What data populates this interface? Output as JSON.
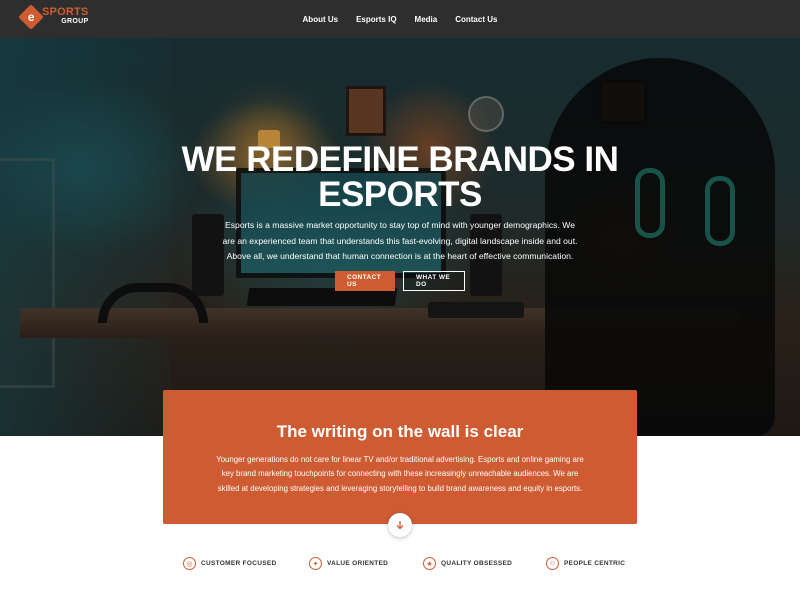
{
  "brand": {
    "logo_mark": "e",
    "logo_top": "SPORTS",
    "logo_bottom": "GROUP",
    "accent_color": "#cf5b32"
  },
  "nav": {
    "items": [
      {
        "label": "About Us"
      },
      {
        "label": "Esports IQ"
      },
      {
        "label": "Media"
      },
      {
        "label": "Contact Us"
      }
    ]
  },
  "hero": {
    "title_line1": "WE REDEFINE BRANDS IN",
    "title_line2": "ESPORTS",
    "text": "Esports is a massive market opportunity to stay top of mind with younger demographics. We are an experienced team that understands this fast-evolving, digital landscape inside and out. Above all, we understand that human connection is at the heart of effective communication.",
    "primary_button": "CONTACT US",
    "secondary_button": "WHAT WE DO"
  },
  "card": {
    "title": "The writing on the wall is clear",
    "text": "Younger generations do not care for linear TV and/or traditional advertising. Esports and online gaming are key brand marketing touchpoints for connecting with these increasingly unreachable audiences. We are skilled at developing strategies and leveraging storytelling to build brand awareness and equity in esports.",
    "scroll_icon": "arrow-down-icon"
  },
  "values": [
    {
      "label": "CUSTOMER FOCUSED",
      "icon": "target-icon"
    },
    {
      "label": "VALUE ORIENTED",
      "icon": "handshake-icon"
    },
    {
      "label": "QUALITY OBSESSED",
      "icon": "award-icon"
    },
    {
      "label": "PEOPLE CENTRIC",
      "icon": "people-icon"
    }
  ]
}
